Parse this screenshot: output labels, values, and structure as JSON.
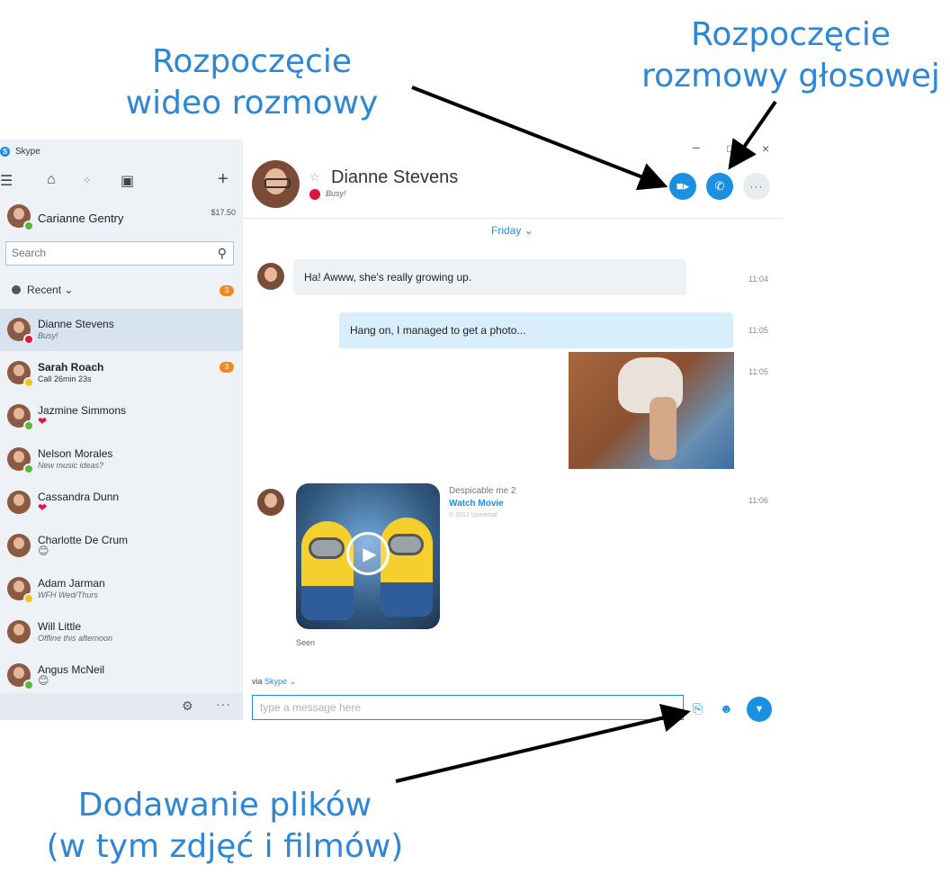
{
  "annotations": {
    "video": [
      "Rozpoczęcie",
      "wideo rozmowy"
    ],
    "voice": [
      "Rozpoczęcie",
      "rozmowy głosowej"
    ],
    "files": [
      "Dodawanie plików",
      "(w tym zdjęć i filmów)"
    ]
  },
  "app": {
    "title": "Skype"
  },
  "sidebar": {
    "profile": {
      "name": "Carianne Gentry",
      "credit": "$17.50"
    },
    "search": {
      "placeholder": "Search"
    },
    "recent": {
      "label": "Recent ⌄",
      "badge": "3"
    },
    "contacts": [
      {
        "name": "Dianne Stevens",
        "status_text": "Busy!",
        "presence": "busy",
        "active": true
      },
      {
        "name": "Sarah Roach",
        "status_text": "Call 26min 23s",
        "presence": "away",
        "badge": "3",
        "bold": true
      },
      {
        "name": "Jazmine Simmons",
        "status_text": "❤",
        "presence": "online"
      },
      {
        "name": "Nelson Morales",
        "status_text": "New music ideas?",
        "presence": "online"
      },
      {
        "name": "Cassandra Dunn",
        "status_text": "❤",
        "presence": "none"
      },
      {
        "name": "Charlotte De Crum",
        "status_text": "😊",
        "presence": "none"
      },
      {
        "name": "Adam Jarman",
        "status_text": "WFH Wed/Thurs",
        "presence": "away"
      },
      {
        "name": "Will Little",
        "status_text": "Offline this afternoon",
        "presence": "none"
      },
      {
        "name": "Angus McNeil",
        "status_text": "😊",
        "presence": "online"
      }
    ]
  },
  "chat": {
    "contact_name": "Dianne Stevens",
    "contact_status": "Busy!",
    "day_label": "Friday ⌄",
    "messages": [
      {
        "text": "Ha! Awww, she's really growing up.",
        "time": "11:04"
      },
      {
        "text": "Hang on, I managed to get a photo...",
        "time": "11:05"
      },
      {
        "text": "",
        "time": "11:05"
      },
      {
        "text": "",
        "time": "11:06"
      }
    ],
    "movie": {
      "title": "Despicable me 2",
      "link": "Watch Movie",
      "copyright": "© 2013 Universal"
    },
    "seen_label": "Seen",
    "via_prefix": "via",
    "via_link": "Skype ⌄",
    "compose_placeholder": "type a message here"
  },
  "colors": {
    "accent": "#1b8fe0",
    "annotation": "#2e86d4",
    "busy": "#e0143a",
    "online": "#5cb936",
    "away": "#f6c21a",
    "badge": "#f08a24"
  }
}
